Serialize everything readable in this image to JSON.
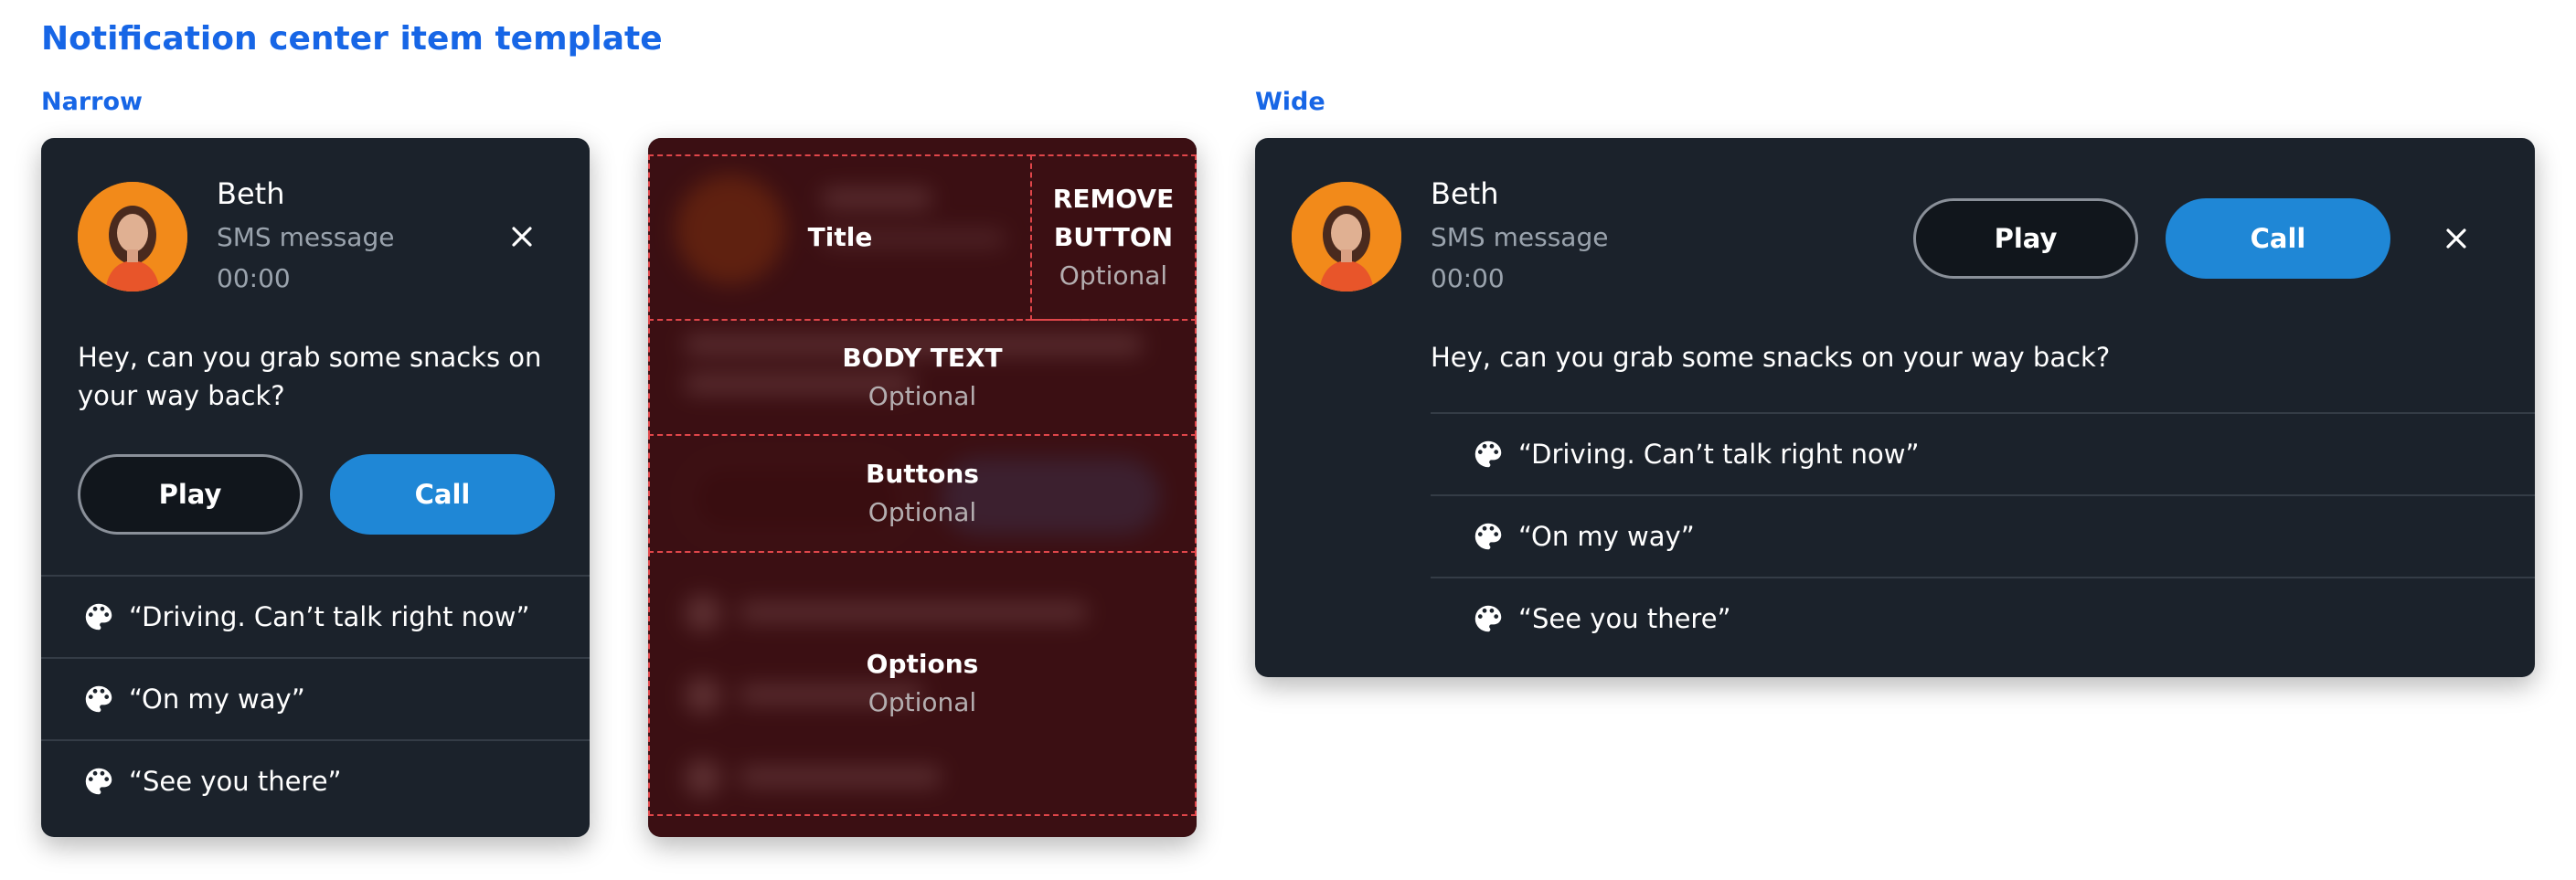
{
  "page": {
    "title": "Notification center item template",
    "section_narrow": "Narrow",
    "section_wide": "Wide"
  },
  "notification": {
    "name": "Beth",
    "type": "SMS message",
    "time": "00:00",
    "body": "Hey, can you grab some snacks on your way back?",
    "buttons": {
      "play": "Play",
      "call": "Call"
    },
    "options": [
      {
        "icon": "palette-icon",
        "label": "“Driving. Can’t talk right now”"
      },
      {
        "icon": "palette-icon",
        "label": "“On my way”"
      },
      {
        "icon": "palette-icon",
        "label": "“See you there”"
      }
    ]
  },
  "anatomy": {
    "title": {
      "label": "Title"
    },
    "remove_button": {
      "label_line1": "REMOVE",
      "label_line2": "BUTTON",
      "sub": "Optional"
    },
    "body_text": {
      "label": "BODY TEXT",
      "sub": "Optional"
    },
    "buttons": {
      "label": "Buttons",
      "sub": "Optional"
    },
    "options": {
      "label": "Options",
      "sub": "Optional"
    }
  },
  "colors": {
    "accent": "#1766e6",
    "card_bg": "#1b222b",
    "call_button": "#1f87d6",
    "avatar_bg": "#f28a1a",
    "zone_border": "#e0464a"
  }
}
